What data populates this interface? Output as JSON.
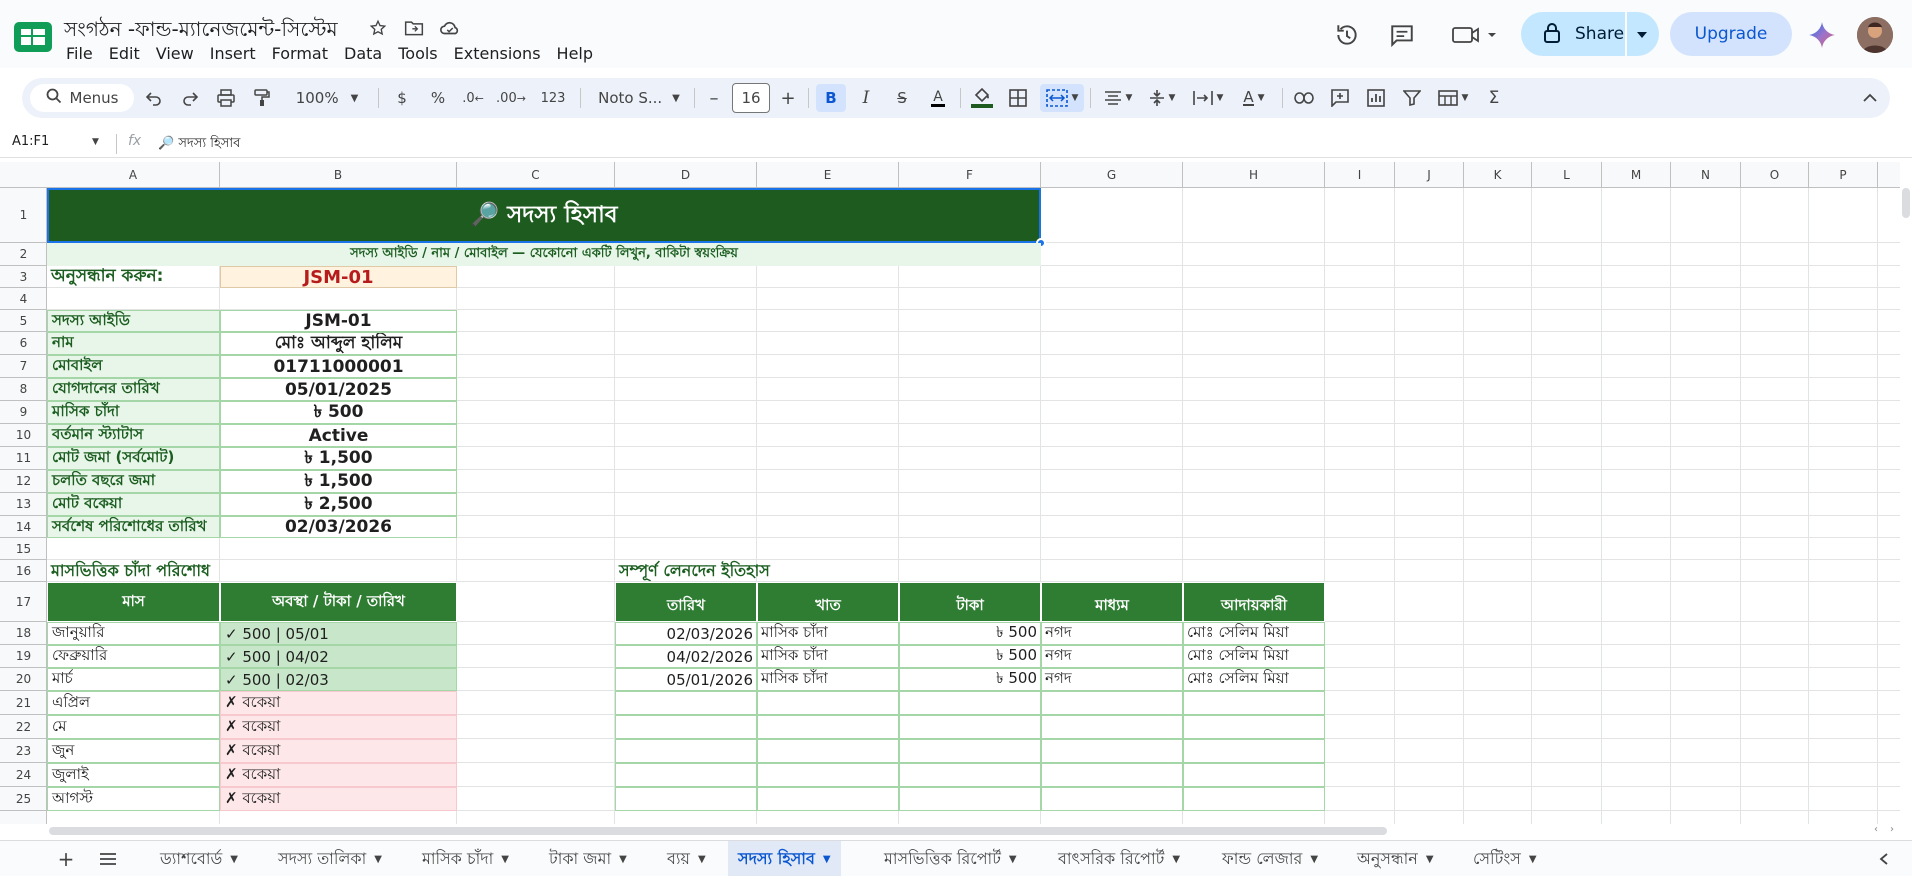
{
  "app": {
    "title": "সংগঠন -ফান্ড-ম্যানেজমেন্ট-সিস্টেম",
    "menu": [
      "File",
      "Edit",
      "View",
      "Insert",
      "Format",
      "Data",
      "Tools",
      "Extensions",
      "Help"
    ],
    "share_label": "Share",
    "upgrade_label": "Upgrade"
  },
  "toolbar": {
    "menus_label": "Menus",
    "zoom": "100%",
    "currency": "$",
    "percent": "%",
    "dec_decrease": ".0",
    "dec_increase": ".00",
    "number_format": "123",
    "font_name": "Noto S...",
    "font_size": "16",
    "minus": "–",
    "plus": "+"
  },
  "formula_bar": {
    "name_box": "A1:F1",
    "fx": "fx",
    "content": "🔎 সদস্য হিসাব"
  },
  "columns": [
    "A",
    "B",
    "C",
    "D",
    "E",
    "F",
    "G",
    "H",
    "I",
    "J",
    "K",
    "L",
    "M",
    "N",
    "O",
    "P"
  ],
  "rows": [
    "1",
    "2",
    "3",
    "4",
    "5",
    "6",
    "7",
    "8",
    "9",
    "10",
    "11",
    "12",
    "13",
    "14",
    "15",
    "16",
    "17",
    "18",
    "19",
    "20",
    "21",
    "22",
    "23",
    "24",
    "25"
  ],
  "sheet": {
    "banner_title": "🔎 সদস্য হিসাব",
    "subtitle": "সদস্য আইডি / নাম / মোবাইল — যেকোনো একটি লিখুন, বাকিটা স্বয়ংক্রিয়",
    "search_label": "অনুসন্ধান করুন:",
    "search_value": "JSM-01",
    "info": [
      {
        "label": "সদস্য আইডি",
        "value": "JSM-01"
      },
      {
        "label": "নাম",
        "value": "মোঃ আব্দুল হালিম"
      },
      {
        "label": "মোবাইল",
        "value": "01711000001"
      },
      {
        "label": "যোগদানের তারিখ",
        "value": "05/01/2025"
      },
      {
        "label": "মাসিক চাঁদা",
        "value": "৳ 500"
      },
      {
        "label": "বর্তমান স্ট্যাটাস",
        "value": "Active"
      },
      {
        "label": "মোট জমা (সর্বমোট)",
        "value": "৳ 1,500"
      },
      {
        "label": "চলতি বছরে জমা",
        "value": "৳ 1,500"
      },
      {
        "label": "মোট বকেয়া",
        "value": "৳ 2,500"
      },
      {
        "label": "সর্বশেষ পরিশোধের তারিখ",
        "value": "02/03/2026"
      }
    ],
    "monthly_title": "মাসভিত্তিক চাঁদা পরিশোধ",
    "monthly_headers": [
      "মাস",
      "অবস্থা / টাকা / তারিখ"
    ],
    "monthly": [
      {
        "month": "জানুয়ারি",
        "status": "✓ 500 | 05/01",
        "paid": true
      },
      {
        "month": "ফেব্রুয়ারি",
        "status": "✓ 500 | 04/02",
        "paid": true
      },
      {
        "month": "মার্চ",
        "status": "✓ 500 | 02/03",
        "paid": true
      },
      {
        "month": "এপ্রিল",
        "status": "✗ বকেয়া",
        "paid": false
      },
      {
        "month": "মে",
        "status": "✗ বকেয়া",
        "paid": false
      },
      {
        "month": "জুন",
        "status": "✗ বকেয়া",
        "paid": false
      },
      {
        "month": "জুলাই",
        "status": "✗ বকেয়া",
        "paid": false
      },
      {
        "month": "আগস্ট",
        "status": "✗ বকেয়া",
        "paid": false
      }
    ],
    "history_title": "সম্পূর্ণ লেনদেন ইতিহাস",
    "history_headers": [
      "তারিখ",
      "খাত",
      "টাকা",
      "মাধ্যম",
      "আদায়কারী"
    ],
    "history": [
      [
        "02/03/2026",
        "মাসিক চাঁদা",
        "৳ 500",
        "নগদ",
        "মোঃ সেলিম মিয়া"
      ],
      [
        "04/02/2026",
        "মাসিক চাঁদা",
        "৳ 500",
        "নগদ",
        "মোঃ সেলিম মিয়া"
      ],
      [
        "05/01/2026",
        "মাসিক চাঁদা",
        "৳ 500",
        "নগদ",
        "মোঃ সেলিম মিয়া"
      ]
    ]
  },
  "tabs": [
    {
      "label": "ড্যাশবোর্ড",
      "active": false
    },
    {
      "label": "সদস্য তালিকা",
      "active": false
    },
    {
      "label": "মাসিক চাঁদা",
      "active": false
    },
    {
      "label": "টাকা জমা",
      "active": false
    },
    {
      "label": "ব্যয়",
      "active": false
    },
    {
      "label": "সদস্য হিসাব",
      "active": true
    },
    {
      "label": "মাসভিত্তিক রিপোর্ট",
      "active": false
    },
    {
      "label": "বাৎসরিক রিপোর্ট",
      "active": false
    },
    {
      "label": "ফান্ড লেজার",
      "active": false
    },
    {
      "label": "অনুসন্ধান",
      "active": false
    },
    {
      "label": "সেটিংস",
      "active": false
    }
  ],
  "colors": {
    "green_dark": "#1e5b1f",
    "green_header": "#2e7d32",
    "green_label": "#e8f5e9",
    "paid_bg": "#c8e6c9",
    "due_bg": "#fde7e9",
    "search_bg": "#fff3e0",
    "accent_blue": "#0b57d0"
  },
  "icons": [
    "sheets-logo-icon",
    "star-icon",
    "move-folder-icon",
    "cloud-status-icon",
    "history-icon",
    "comment-icon",
    "meet-icon",
    "lock-icon",
    "gemini-icon",
    "search-icon",
    "undo-icon",
    "redo-icon",
    "print-icon",
    "paint-format-icon",
    "bold-icon",
    "italic-icon",
    "strikethrough-icon",
    "text-color-icon",
    "fill-color-icon",
    "borders-icon",
    "merge-icon",
    "align-icon",
    "valign-icon",
    "wrap-icon",
    "rotate-icon",
    "link-icon",
    "comment-add-icon",
    "chart-icon",
    "filter-icon",
    "table-icon",
    "sum-icon",
    "collapse-icon",
    "add-sheet-icon",
    "all-sheets-icon"
  ]
}
